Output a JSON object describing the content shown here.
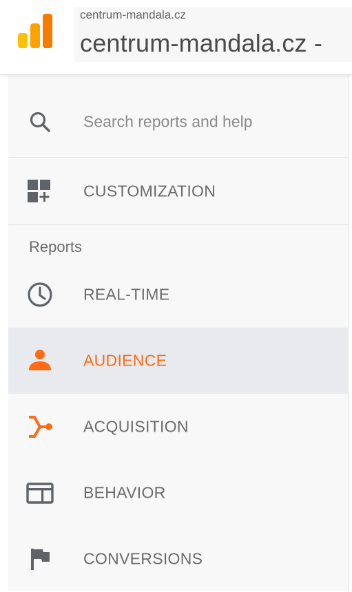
{
  "header": {
    "account_small": "centrum-mandala.cz",
    "account_large": "centrum-mandala.cz -"
  },
  "sidebar": {
    "search_placeholder": "Search reports and help",
    "customization_label": "CUSTOMIZATION",
    "section_title": "Reports",
    "items": [
      {
        "label": "REAL-TIME",
        "icon": "clock-icon",
        "active": false
      },
      {
        "label": "AUDIENCE",
        "icon": "person-icon",
        "active": true
      },
      {
        "label": "ACQUISITION",
        "icon": "acquisition-icon",
        "active": false
      },
      {
        "label": "BEHAVIOR",
        "icon": "behavior-icon",
        "active": false
      },
      {
        "label": "CONVERSIONS",
        "icon": "flag-icon",
        "active": false
      }
    ]
  },
  "colors": {
    "accent": "#ff6a13",
    "logo_dark": "#f57c00",
    "logo_light": "#ffc107",
    "icon_gray": "#5f6368",
    "active_bg": "#e8eaed"
  }
}
